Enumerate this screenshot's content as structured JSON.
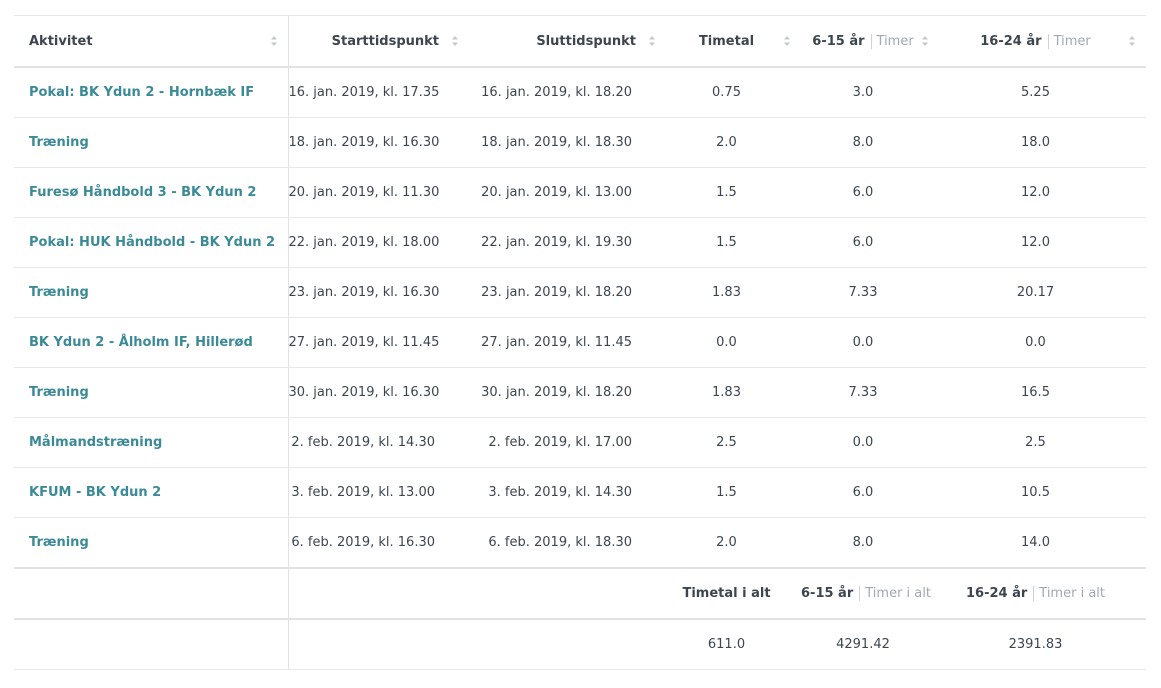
{
  "table": {
    "headers": {
      "activity": "Aktivitet",
      "start": "Starttidspunkt",
      "end": "Sluttidspunkt",
      "hours": "Timetal",
      "age_group_1": "6-15 år",
      "age_group_1_sub": "Timer",
      "age_group_2": "16-24 år",
      "age_group_2_sub": "Timer"
    },
    "rows": [
      {
        "activity": "Pokal: BK Ydun 2 - Hornbæk IF",
        "start": "16. jan. 2019, kl. 17.35",
        "end": "16. jan. 2019, kl. 18.20",
        "hours": "0.75",
        "y1": "3.0",
        "y2": "5.25"
      },
      {
        "activity": "Træning",
        "start": "18. jan. 2019, kl. 16.30",
        "end": "18. jan. 2019, kl. 18.30",
        "hours": "2.0",
        "y1": "8.0",
        "y2": "18.0"
      },
      {
        "activity": "Furesø Håndbold 3 - BK Ydun 2",
        "start": "20. jan. 2019, kl. 11.30",
        "end": "20. jan. 2019, kl. 13.00",
        "hours": "1.5",
        "y1": "6.0",
        "y2": "12.0"
      },
      {
        "activity": "Pokal: HUK Håndbold - BK Ydun 2",
        "start": "22. jan. 2019, kl. 18.00",
        "end": "22. jan. 2019, kl. 19.30",
        "hours": "1.5",
        "y1": "6.0",
        "y2": "12.0"
      },
      {
        "activity": "Træning",
        "start": "23. jan. 2019, kl. 16.30",
        "end": "23. jan. 2019, kl. 18.20",
        "hours": "1.83",
        "y1": "7.33",
        "y2": "20.17"
      },
      {
        "activity": "BK Ydun 2 - Ålholm IF, Hillerød",
        "start": "27. jan. 2019, kl. 11.45",
        "end": "27. jan. 2019, kl. 11.45",
        "hours": "0.0",
        "y1": "0.0",
        "y2": "0.0"
      },
      {
        "activity": "Træning",
        "start": "30. jan. 2019, kl. 16.30",
        "end": "30. jan. 2019, kl. 18.20",
        "hours": "1.83",
        "y1": "7.33",
        "y2": "16.5"
      },
      {
        "activity": "Målmandstræning",
        "start": "2. feb. 2019, kl. 14.30",
        "end": "2. feb. 2019, kl. 17.00",
        "hours": "2.5",
        "y1": "0.0",
        "y2": "2.5"
      },
      {
        "activity": "KFUM - BK Ydun 2",
        "start": "3. feb. 2019, kl. 13.00",
        "end": "3. feb. 2019, kl. 14.30",
        "hours": "1.5",
        "y1": "6.0",
        "y2": "10.5"
      },
      {
        "activity": "Træning",
        "start": "6. feb. 2019, kl. 16.30",
        "end": "6. feb. 2019, kl. 18.30",
        "hours": "2.0",
        "y1": "8.0",
        "y2": "14.0"
      }
    ],
    "totals": {
      "hours_label": "Timetal i alt",
      "age_group_1": "6-15 år",
      "age_group_1_sub": "Timer i alt",
      "age_group_2": "16-24 år",
      "age_group_2_sub": "Timer i alt",
      "hours": "611.0",
      "y1": "4291.42",
      "y2": "2391.83"
    }
  },
  "icons": {
    "sort": "sort-icon"
  },
  "colors": {
    "link": "#3b8a97",
    "text": "#3d4650",
    "muted": "#a3a9b0",
    "border": "#e2e2e2"
  }
}
